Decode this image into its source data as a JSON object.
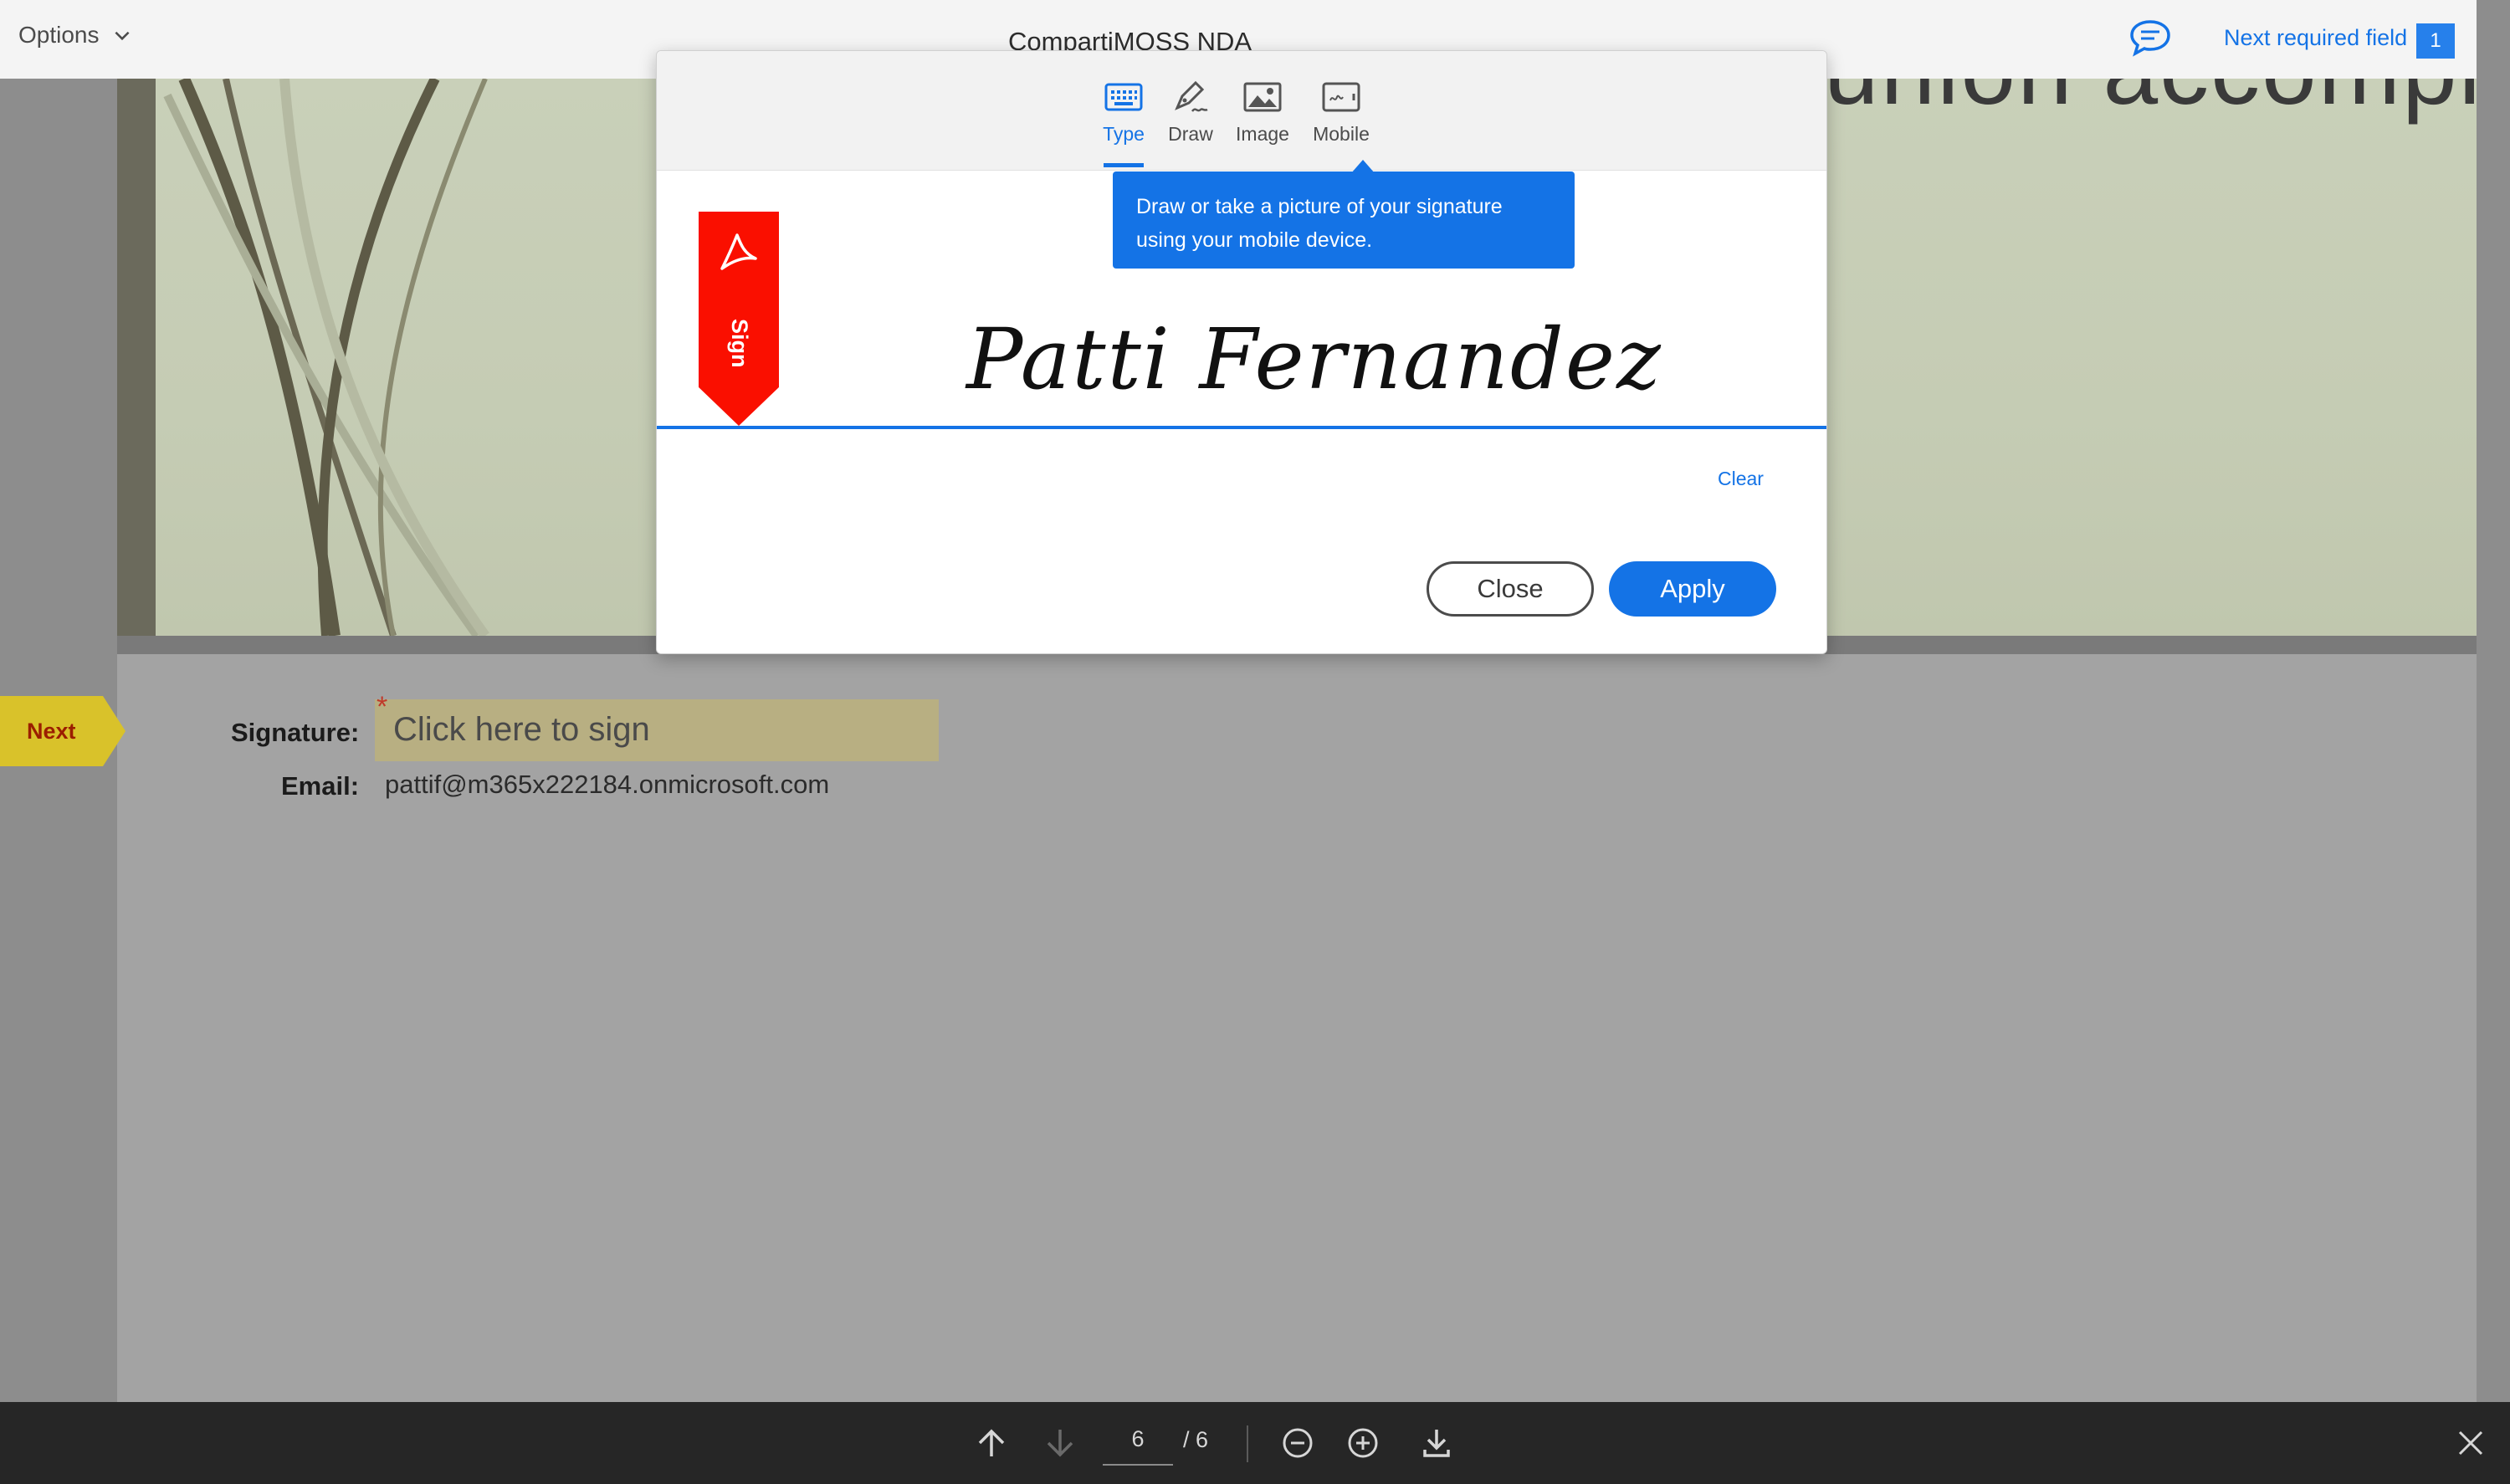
{
  "header": {
    "options_label": "Options",
    "document_title": "CompartiMOSS NDA",
    "next_required_label": "Next required field",
    "next_required_count": "1"
  },
  "document": {
    "banner_heading": "union accomplish",
    "next_tag": "Next",
    "signature_label": "Signature:",
    "signature_placeholder": "Click here to sign",
    "required_mark": "*",
    "email_label": "Email:",
    "email_value": "pattif@m365x222184.onmicrosoft.com"
  },
  "modal": {
    "tabs": [
      {
        "label": "Type",
        "icon": "keyboard-icon",
        "active": true
      },
      {
        "label": "Draw",
        "icon": "pen-icon",
        "active": false
      },
      {
        "label": "Image",
        "icon": "image-icon",
        "active": false
      },
      {
        "label": "Mobile",
        "icon": "mobile-icon",
        "active": false
      }
    ],
    "tooltip": "Draw or take a picture of your signature using your mobile device.",
    "sign_ribbon_label": "Sign",
    "signature_text": "Patti Fernandez",
    "clear_label": "Clear",
    "close_label": "Close",
    "apply_label": "Apply"
  },
  "toolbar": {
    "current_page": "6",
    "total_pages": "/ 6"
  },
  "colors": {
    "accent": "#1473e6",
    "adobe_red": "#fa0f00",
    "next_tag": "#d9c22a",
    "toolbar_bg": "#262626"
  }
}
